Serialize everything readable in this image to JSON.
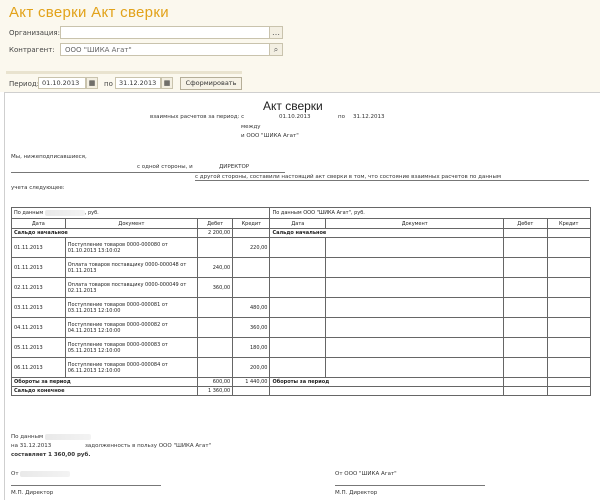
{
  "window": {
    "title": "Акт сверки Акт сверки"
  },
  "form": {
    "org_label": "Организация:",
    "org_value": "",
    "contractor_label": "Контрагент:",
    "contractor_value": "ООО \"ШИКА Агат\"",
    "period_label": "Период:",
    "date_from": "01.10.2013",
    "date_sep": "по",
    "date_to": "31.12.2013",
    "generate_label": "Сформировать"
  },
  "doc": {
    "title": "Акт сверки",
    "sub1": "взаимных расчетов за период: с",
    "sub1_from": "01.10.2013",
    "sub1_sep": "по",
    "sub1_to": "31.12.2013",
    "sub2": "между",
    "sub3": "и ООО \"ШИКА Агат\"",
    "we_label": "Мы, нижеподписавшиеся,",
    "we_role": "с одной стороны, и",
    "we_role2": "ДИРЕКТОР",
    "legal_text": "с другой стороны, составили настоящий акт сверки в том, что состояние взаимных расчетов по данным",
    "legal_text2": "учета следующее:",
    "left_heading": "По данным",
    "left_currency": ", руб.",
    "right_heading": "По данным ООО \"ШИКА Агат\", руб.",
    "columns": [
      "Дата",
      "Документ",
      "Дебет",
      "Кредит"
    ],
    "opening_label": "Сальдо начальное",
    "opening_debit": "2 200,00",
    "opening_right_label": "Сальдо начальное",
    "turnover_label": "Обороты за период",
    "turnover_debit": "600,00",
    "turnover_credit": "1 440,00",
    "turnover_right_label": "Обороты за период",
    "closing_label": "Сальдо конечное",
    "closing_debit": "1 360,00",
    "rows": [
      {
        "date": "01.11.2013",
        "doc": "Поступление товаров 0000-000080 от 01.10.2013 13:10:02",
        "debit": "",
        "credit": "220,00"
      },
      {
        "date": "01.11.2013",
        "doc": "Оплата товаров поставщику 0000-000048 от 01.11.2013",
        "debit": "240,00",
        "credit": ""
      },
      {
        "date": "02.11.2013",
        "doc": "Оплата товаров поставщику 0000-000049 от 02.11.2013",
        "debit": "360,00",
        "credit": ""
      },
      {
        "date": "03.11.2013",
        "doc": "Поступление товаров 0000-000081 от 03.11.2013 12:10:00",
        "debit": "",
        "credit": "480,00"
      },
      {
        "date": "04.11.2013",
        "doc": "Поступление товаров 0000-000082 от 04.11.2013 12:10:00",
        "debit": "",
        "credit": "360,00"
      },
      {
        "date": "05.11.2013",
        "doc": "Поступление товаров 0000-000083 от 05.11.2013 12:10:00",
        "debit": "",
        "credit": "180,00"
      },
      {
        "date": "06.11.2013",
        "doc": "Поступление товаров 0000-000084 от 06.11.2013 12:10:00",
        "debit": "",
        "credit": "200,00"
      }
    ],
    "footer_left1": "По данным",
    "footer_left2": "на 31.12.2013",
    "footer_mid": "задолженность в пользу ООО \"ШИКА Агат\"",
    "footer_left3": "составляет 1 360,00 руб.",
    "footer_from": "От",
    "footer_from_right": "От ООО \"ШИКА Агат\"",
    "footer_sign_left": "М.П. Директор",
    "footer_sign_right": "М.П. Директор"
  }
}
